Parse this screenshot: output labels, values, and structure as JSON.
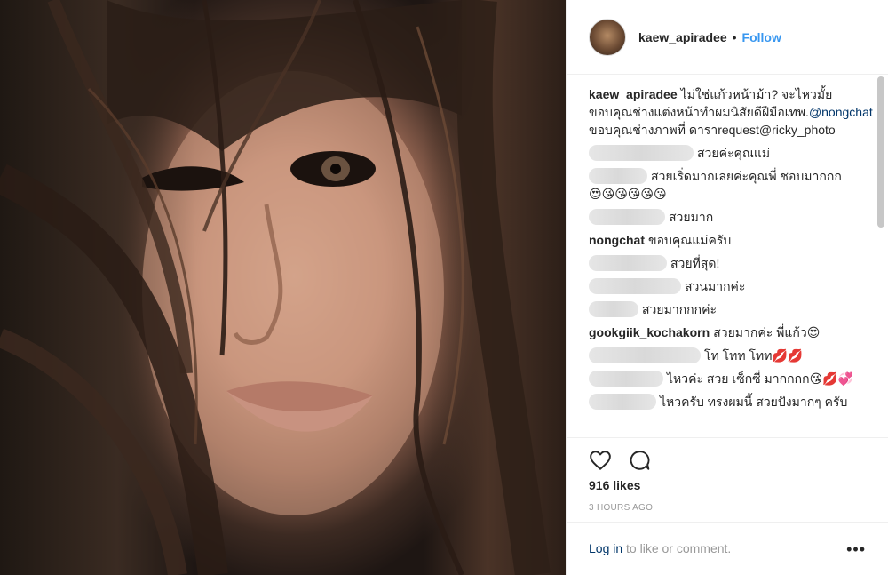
{
  "post": {
    "username": "kaew_apiradee",
    "dot": "•",
    "follow_label": "Follow",
    "caption": {
      "text_1": "ไม่ใช่แก้วหน้าม้า? จะไหวมั้ย ขอบคุณช่างแต่งหน้าทำผมนิสัยดีฝีมือเทพ.",
      "mention_1": "@nongchat",
      "text_2": " ขอบคุณช่างภาพที่ ดาราrequest@ricky_photo"
    },
    "comments": [
      {
        "user": "",
        "text": "สวยค่ะคุณแม่",
        "blur_width": 118,
        "emojis": ""
      },
      {
        "user": "",
        "text": "สวยเริ่ดมากเลยค่ะคุณพี่ ชอบมากกก",
        "blur_width": 66,
        "emojis": "😍😘😘😘😘😘"
      },
      {
        "user": "",
        "text": "สวยมาก",
        "blur_width": 86,
        "emojis": ""
      },
      {
        "user": "nongchat",
        "text": "ขอบคุณแม่ครับ",
        "blur_width": 0,
        "emojis": ""
      },
      {
        "user": "",
        "text": "สวยที่สุด!",
        "blur_width": 88,
        "emojis": ""
      },
      {
        "user": "",
        "text": "สวนมากค่ะ",
        "blur_width": 104,
        "emojis": ""
      },
      {
        "user": "",
        "text": "สวยมากกกค่ะ",
        "blur_width": 56,
        "emojis": ""
      },
      {
        "user": "gookgiik_kochakorn",
        "text": "สวยมากค่ะ พี่แก้ว",
        "blur_width": 0,
        "emojis": "😍"
      },
      {
        "user": "",
        "text": "โท โทท โทท",
        "blur_width": 126,
        "emojis": "💋💋"
      },
      {
        "user": "",
        "text": "ไหวค่ะ สวย เซ็กซี่ มากกกก",
        "blur_width": 84,
        "emojis": "😘💋💞"
      },
      {
        "user": "",
        "text": "ไหวครับ ทรงผมนี้ สวยปังมากๆ ครับ",
        "blur_width": 76,
        "emojis": ""
      }
    ],
    "likes_text": "916 likes",
    "timestamp": "3 HOURS AGO",
    "login_link": "Log in",
    "login_rest": " to like or comment.",
    "more_label": "•••"
  },
  "icons": {
    "like": "heart-icon",
    "comment": "comment-icon",
    "more": "more-options-icon"
  },
  "colors": {
    "accent": "#3897f0",
    "link": "#003569",
    "muted": "#999999",
    "text": "#262626"
  }
}
